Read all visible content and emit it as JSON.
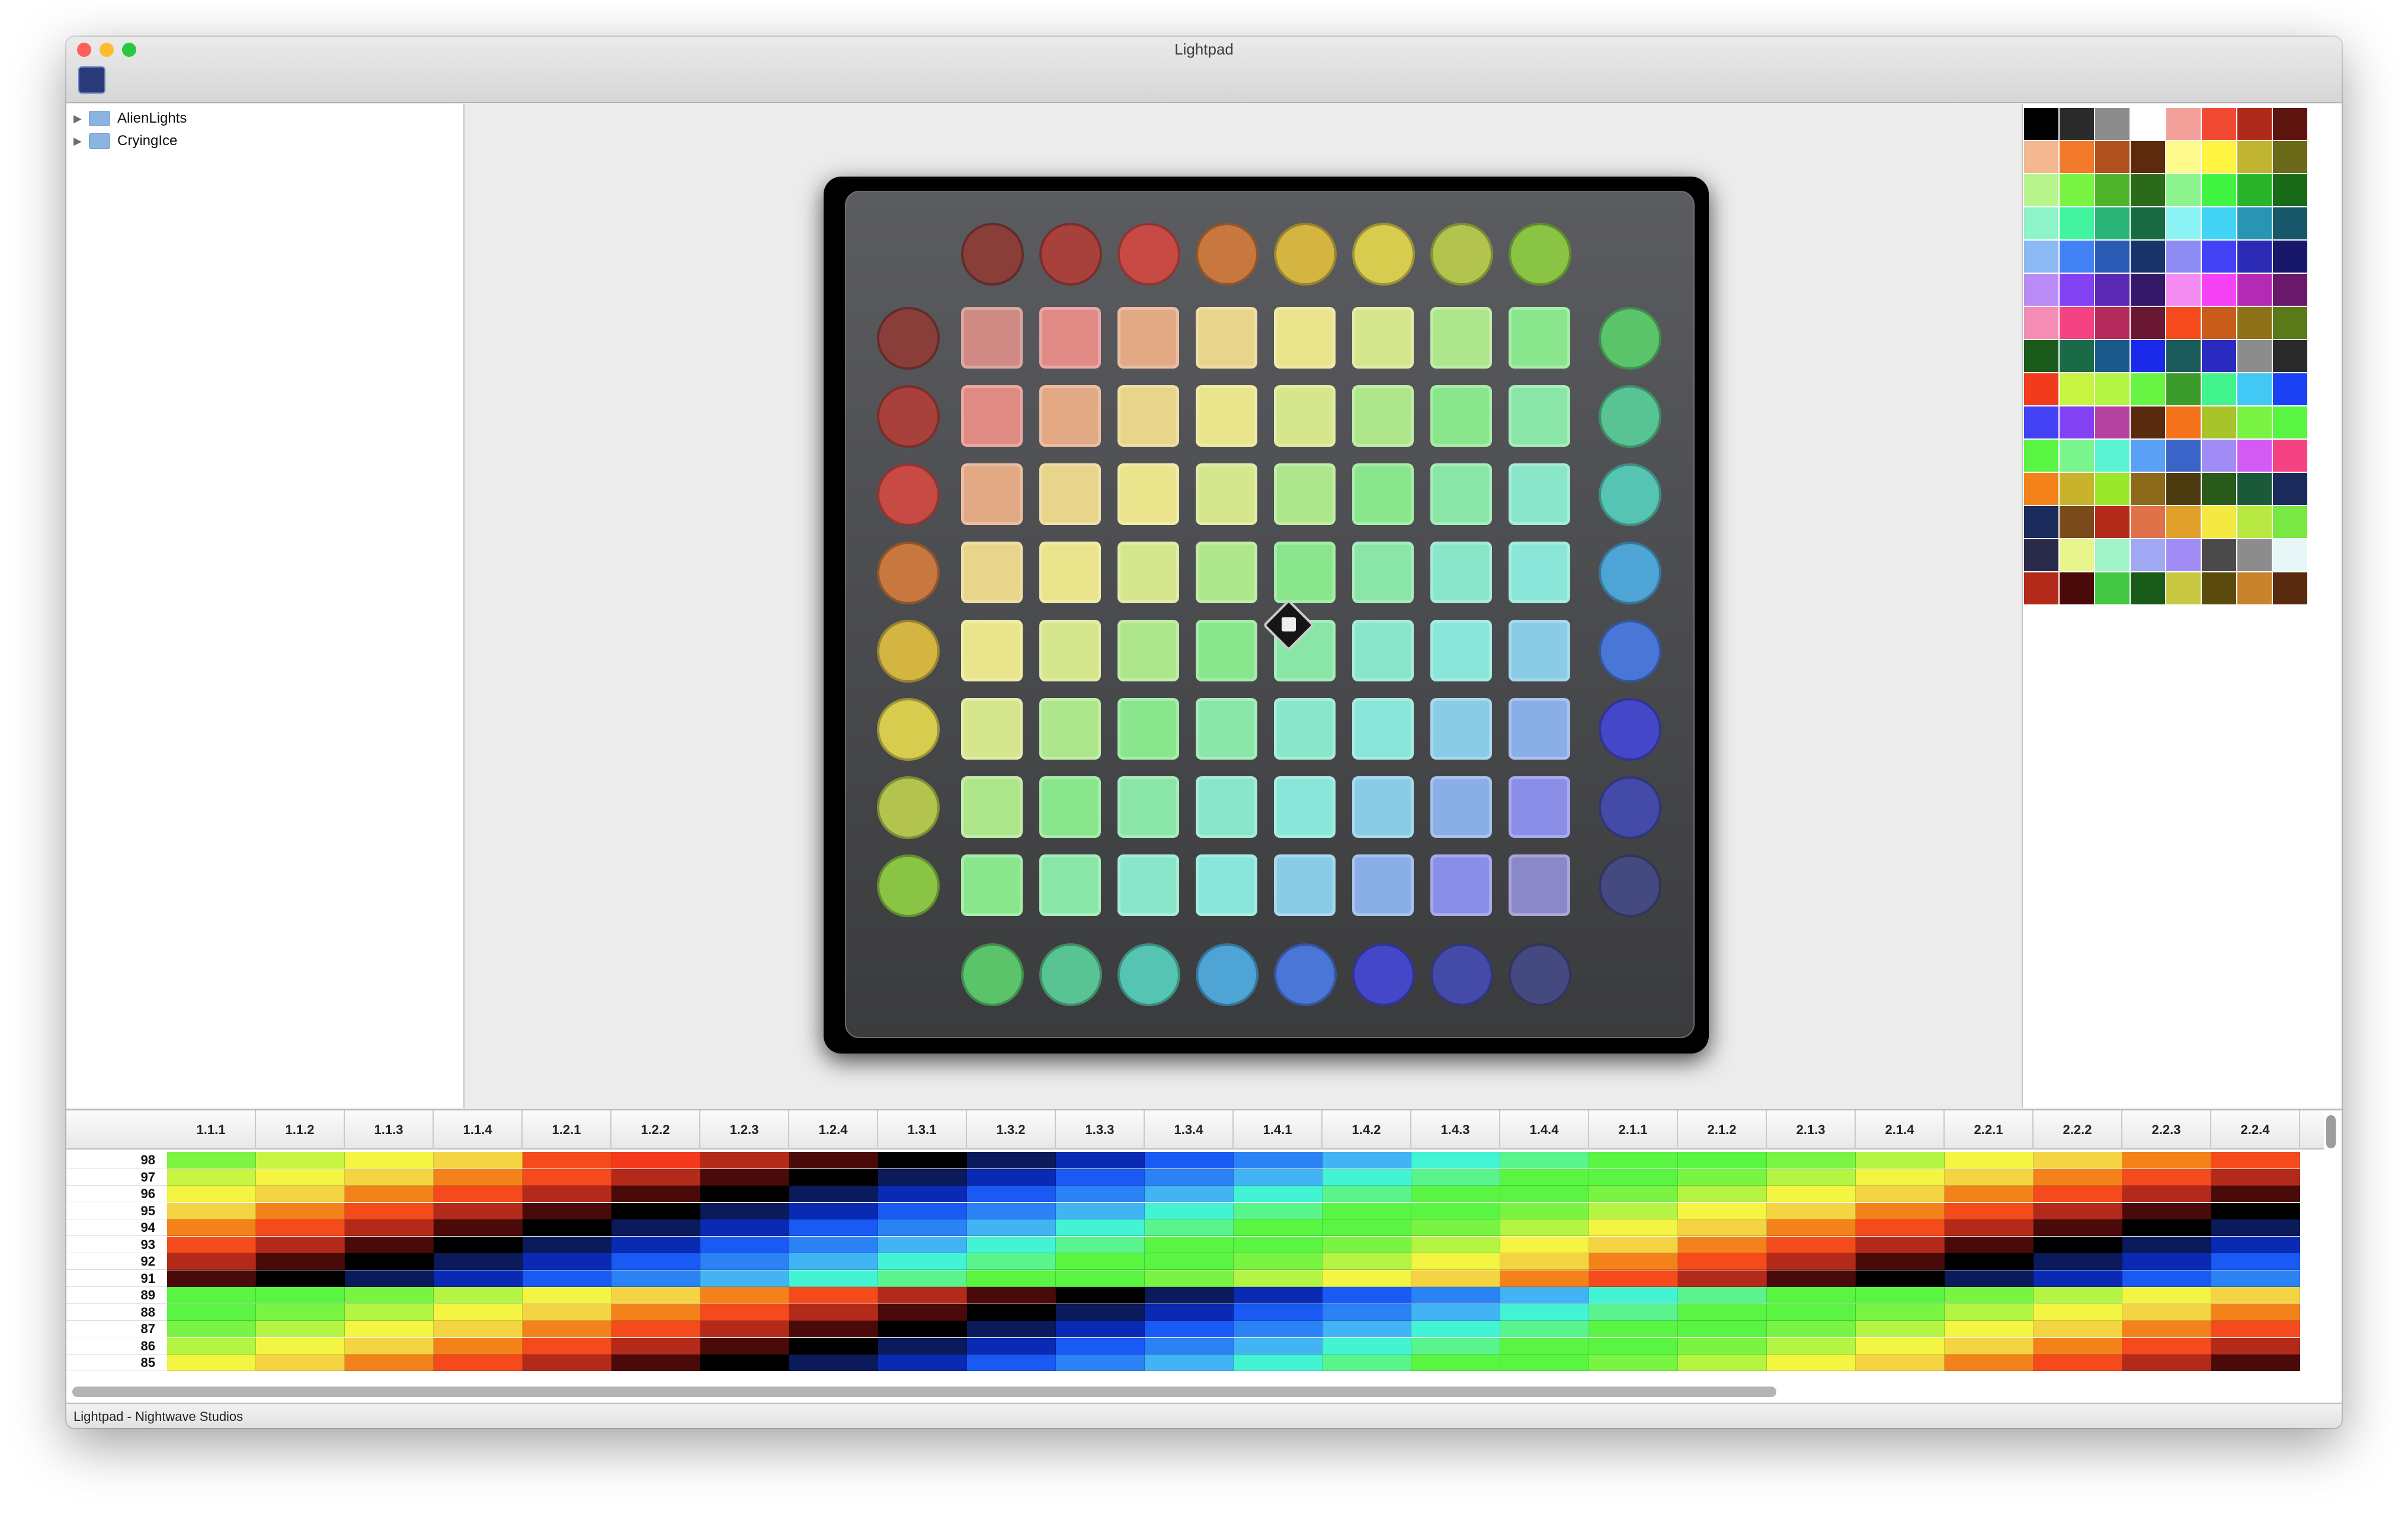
{
  "window": {
    "title": "Lightpad",
    "traffic_lights": {
      "close": "#ff5f57",
      "minimize": "#febc2e",
      "maximize": "#28c840"
    }
  },
  "toolbar": {
    "app_icon": "lightpad-app-icon"
  },
  "sidebar": {
    "items": [
      {
        "label": "AlienLights",
        "icon": "folder-icon",
        "expanded": false
      },
      {
        "label": "CryingIce",
        "icon": "folder-icon",
        "expanded": false
      }
    ]
  },
  "launchpad": {
    "top_buttons": [
      "#8a3e3a",
      "#a8403c",
      "#c84a44",
      "#c8773e",
      "#d4b542",
      "#d8cc4e",
      "#b2c44e",
      "#8ac444"
    ],
    "left_buttons": [
      "#8a3e3a",
      "#a8403c",
      "#c84a44",
      "#c8773e",
      "#d4b542",
      "#d8cc4e",
      "#b2c44e",
      "#8ac444"
    ],
    "right_buttons": [
      "#5bc46a",
      "#58c493",
      "#56c4b2",
      "#4ea4d4",
      "#4a76d8",
      "#4448c8",
      "#444aa8",
      "#444a80"
    ],
    "bottom_buttons": [
      "#5bc46a",
      "#58c493",
      "#56c4b2",
      "#4ea4d4",
      "#4a76d8",
      "#4448c8",
      "#444aa8",
      "#444a80"
    ],
    "pad_rows": [
      [
        "#cf8a84",
        "#e18a86",
        "#e3a884",
        "#e8d48a",
        "#eae48c",
        "#d6e68c",
        "#aee68c",
        "#8ae68c"
      ],
      [
        "#e08a84",
        "#e3a884",
        "#e8d48a",
        "#eae48c",
        "#d6e68c",
        "#aee68c",
        "#8ae68c",
        "#8ae6a6"
      ],
      [
        "#e3a884",
        "#e8d48a",
        "#eae48c",
        "#d6e68c",
        "#aee68c",
        "#8ae68c",
        "#8ae6a6",
        "#8ae6c8"
      ],
      [
        "#e8d48a",
        "#eae48c",
        "#d6e68c",
        "#aee68c",
        "#8ae68c",
        "#8ae6a6",
        "#8ae6c8",
        "#8ae6d8"
      ],
      [
        "#eae48c",
        "#d6e68c",
        "#aee68c",
        "#8ae68c",
        "#8ae6a6",
        "#8ae6c8",
        "#8ae6d8",
        "#8acce6"
      ],
      [
        "#d6e68c",
        "#aee68c",
        "#8ae68c",
        "#8ae6a6",
        "#8ae6c8",
        "#8ae6d8",
        "#8acce6",
        "#8aaee6"
      ],
      [
        "#aee68c",
        "#8ae68c",
        "#8ae6a6",
        "#8ae6c8",
        "#8ae6d8",
        "#8acce6",
        "#8aaee6",
        "#8a8ee6"
      ],
      [
        "#8ae68c",
        "#8ae6a6",
        "#8ae6c8",
        "#8ae6d8",
        "#8acce6",
        "#8aaee6",
        "#8a8ee6",
        "#8a88c8"
      ]
    ],
    "logo_icon": "novation-logo-icon"
  },
  "palette": {
    "swatches": [
      "#000000",
      "#2a2a2a",
      "#8c8c8c",
      "#ffffff",
      "#f4a09a",
      "#f24a32",
      "#b02a1c",
      "#5e140e",
      "#f4b890",
      "#f27a2a",
      "#b0501c",
      "#5e2a0e",
      "#fffa8c",
      "#fff442",
      "#c0b430",
      "#6a6a18",
      "#b8f48c",
      "#7af442",
      "#50b42a",
      "#2a6a18",
      "#8cf48c",
      "#42f442",
      "#2ab42a",
      "#186a18",
      "#8cf4c8",
      "#42f4a0",
      "#2ab478",
      "#186a42",
      "#8cf4f4",
      "#42d4f4",
      "#2a94b4",
      "#18566a",
      "#8cb8f4",
      "#4282f4",
      "#2a5ab4",
      "#18346a",
      "#8c8cf4",
      "#4242f4",
      "#2a2ab4",
      "#18186a",
      "#b88cf4",
      "#8242f4",
      "#5a2ab4",
      "#34186a",
      "#f48cf4",
      "#f442f4",
      "#b42ab4",
      "#6a186a",
      "#f48cb4",
      "#f44282",
      "#b42a5a",
      "#6a1834",
      "#f44a1c",
      "#c85c1a",
      "#8e7218",
      "#5a7a1a",
      "#1a5a1a",
      "#1a6a48",
      "#1a5a8a",
      "#1a2ae8",
      "#1a5a5a",
      "#2a2ac0",
      "#8c8c8c",
      "#2a2a2a",
      "#f23a1c",
      "#c8f442",
      "#b4f442",
      "#68f442",
      "#3a9a2a",
      "#42f48c",
      "#42c8f4",
      "#1a42f4",
      "#4242f4",
      "#8242f4",
      "#b442a0",
      "#5a2a0e",
      "#f4721a",
      "#a8c42a",
      "#7af442",
      "#5af442",
      "#5af442",
      "#7af48c",
      "#5af4d4",
      "#5aa0f4",
      "#3a64c8",
      "#a08cf4",
      "#d45af4",
      "#f44282",
      "#f4821a",
      "#c8b42a",
      "#9ae82a",
      "#8c6a1a",
      "#4a3a0e",
      "#2a5a1a",
      "#1a5a3a",
      "#1a2a5a",
      "#1a2a5a",
      "#7a4a1a",
      "#b42a1a",
      "#e0724a",
      "#e0a02a",
      "#f4e842",
      "#b8e842",
      "#7ae842",
      "#2a2a4a",
      "#e8f48c",
      "#a0f4c8",
      "#a0a8f4",
      "#a08cf4",
      "#4a4a4a",
      "#8c8c8c",
      "#e8f8f8",
      "#b42a1a",
      "#4a0a0a",
      "#42c842",
      "#1a5a1a",
      "#c8c842",
      "#5a4a0e",
      "#c8822a",
      "#5a2a0e"
    ]
  },
  "grid": {
    "columns": [
      "1.1.1",
      "1.1.2",
      "1.1.3",
      "1.1.4",
      "1.2.1",
      "1.2.2",
      "1.2.3",
      "1.2.4",
      "1.3.1",
      "1.3.2",
      "1.3.3",
      "1.3.4",
      "1.4.1",
      "1.4.2",
      "1.4.3",
      "1.4.4",
      "2.1.1",
      "2.1.2",
      "2.1.3",
      "2.1.4",
      "2.2.1",
      "2.2.2",
      "2.2.3",
      "2.2.4"
    ],
    "rows": [
      {
        "label": "98",
        "colors": [
          "#7df442",
          "#c8f442",
          "#f4f442",
          "#f4d442",
          "#f44a1c",
          "#f43a1c",
          "#b42a1a",
          "#4a0a0a",
          "#000000",
          "#0a1a5a",
          "#0a2ab4",
          "#1a5af4",
          "#2a82f4",
          "#42b4f4",
          "#42f4d4",
          "#5af48c",
          "#5af442",
          "#5af442",
          "#7af442",
          "#b4f442",
          "#f4f442",
          "#f4d442",
          "#f4821a",
          "#f44a1c"
        ]
      },
      {
        "label": "97",
        "colors": [
          "#c8f442",
          "#f4f442",
          "#f4d442",
          "#f4821a",
          "#f44a1c",
          "#b42a1a",
          "#4a0a0a",
          "#000000",
          "#0a1a5a",
          "#0a2ab4",
          "#1a5af4",
          "#2a82f4",
          "#42b4f4",
          "#42f4d4",
          "#5af48c",
          "#5af442",
          "#5af442",
          "#7af442",
          "#b4f442",
          "#f4f442",
          "#f4d442",
          "#f4821a",
          "#f44a1c",
          "#b42a1a"
        ]
      },
      {
        "label": "96",
        "colors": [
          "#f4f442",
          "#f4d442",
          "#f4821a",
          "#f44a1c",
          "#b42a1a",
          "#4a0a0a",
          "#000000",
          "#0a1a5a",
          "#0a2ab4",
          "#1a5af4",
          "#2a82f4",
          "#42b4f4",
          "#42f4d4",
          "#5af48c",
          "#5af442",
          "#5af442",
          "#7af442",
          "#b4f442",
          "#f4f442",
          "#f4d442",
          "#f4821a",
          "#f44a1c",
          "#b42a1a",
          "#4a0a0a"
        ]
      },
      {
        "label": "95",
        "colors": [
          "#f4d442",
          "#f4821a",
          "#f44a1c",
          "#b42a1a",
          "#4a0a0a",
          "#000000",
          "#0a1a5a",
          "#0a2ab4",
          "#1a5af4",
          "#2a82f4",
          "#42b4f4",
          "#42f4d4",
          "#5af48c",
          "#5af442",
          "#5af442",
          "#7af442",
          "#b4f442",
          "#f4f442",
          "#f4d442",
          "#f4821a",
          "#f44a1c",
          "#b42a1a",
          "#4a0a0a",
          "#000000"
        ]
      },
      {
        "label": "94",
        "colors": [
          "#f4821a",
          "#f44a1c",
          "#b42a1a",
          "#4a0a0a",
          "#000000",
          "#0a1a5a",
          "#0a2ab4",
          "#1a5af4",
          "#2a82f4",
          "#42b4f4",
          "#42f4d4",
          "#5af48c",
          "#5af442",
          "#5af442",
          "#7af442",
          "#b4f442",
          "#f4f442",
          "#f4d442",
          "#f4821a",
          "#f44a1c",
          "#b42a1a",
          "#4a0a0a",
          "#000000",
          "#0a1a5a"
        ]
      },
      {
        "label": "93",
        "colors": [
          "#f44a1c",
          "#b42a1a",
          "#4a0a0a",
          "#000000",
          "#0a1a5a",
          "#0a2ab4",
          "#1a5af4",
          "#2a82f4",
          "#42b4f4",
          "#42f4d4",
          "#5af48c",
          "#5af442",
          "#5af442",
          "#7af442",
          "#b4f442",
          "#f4f442",
          "#f4d442",
          "#f4821a",
          "#f44a1c",
          "#b42a1a",
          "#4a0a0a",
          "#000000",
          "#0a1a5a",
          "#0a2ab4"
        ]
      },
      {
        "label": "92",
        "colors": [
          "#b42a1a",
          "#4a0a0a",
          "#000000",
          "#0a1a5a",
          "#0a2ab4",
          "#1a5af4",
          "#2a82f4",
          "#42b4f4",
          "#42f4d4",
          "#5af48c",
          "#5af442",
          "#5af442",
          "#7af442",
          "#b4f442",
          "#f4f442",
          "#f4d442",
          "#f4821a",
          "#f44a1c",
          "#b42a1a",
          "#4a0a0a",
          "#000000",
          "#0a1a5a",
          "#0a2ab4",
          "#1a5af4"
        ]
      },
      {
        "label": "91",
        "colors": [
          "#4a0a0a",
          "#000000",
          "#0a1a5a",
          "#0a2ab4",
          "#1a5af4",
          "#2a82f4",
          "#42b4f4",
          "#42f4d4",
          "#5af48c",
          "#5af442",
          "#5af442",
          "#7af442",
          "#b4f442",
          "#f4f442",
          "#f4d442",
          "#f4821a",
          "#f44a1c",
          "#b42a1a",
          "#4a0a0a",
          "#000000",
          "#0a1a5a",
          "#0a2ab4",
          "#1a5af4",
          "#2a82f4"
        ]
      },
      {
        "label": "89",
        "colors": [
          "#5af442",
          "#5af442",
          "#7af442",
          "#b4f442",
          "#f4f442",
          "#f4d442",
          "#f4821a",
          "#f44a1c",
          "#b42a1a",
          "#4a0a0a",
          "#000000",
          "#0a1a5a",
          "#0a2ab4",
          "#1a5af4",
          "#2a82f4",
          "#42b4f4",
          "#42f4d4",
          "#5af48c",
          "#5af442",
          "#5af442",
          "#7af442",
          "#b4f442",
          "#f4f442",
          "#f4d442"
        ]
      },
      {
        "label": "88",
        "colors": [
          "#5af442",
          "#7af442",
          "#b4f442",
          "#f4f442",
          "#f4d442",
          "#f4821a",
          "#f44a1c",
          "#b42a1a",
          "#4a0a0a",
          "#000000",
          "#0a1a5a",
          "#0a2ab4",
          "#1a5af4",
          "#2a82f4",
          "#42b4f4",
          "#42f4d4",
          "#5af48c",
          "#5af442",
          "#5af442",
          "#7af442",
          "#b4f442",
          "#f4f442",
          "#f4d442",
          "#f4821a"
        ]
      },
      {
        "label": "87",
        "colors": [
          "#7af442",
          "#b4f442",
          "#f4f442",
          "#f4d442",
          "#f4821a",
          "#f44a1c",
          "#b42a1a",
          "#4a0a0a",
          "#000000",
          "#0a1a5a",
          "#0a2ab4",
          "#1a5af4",
          "#2a82f4",
          "#42b4f4",
          "#42f4d4",
          "#5af48c",
          "#5af442",
          "#5af442",
          "#7af442",
          "#b4f442",
          "#f4f442",
          "#f4d442",
          "#f4821a",
          "#f44a1c"
        ]
      },
      {
        "label": "86",
        "colors": [
          "#b4f442",
          "#f4f442",
          "#f4d442",
          "#f4821a",
          "#f44a1c",
          "#b42a1a",
          "#4a0a0a",
          "#000000",
          "#0a1a5a",
          "#0a2ab4",
          "#1a5af4",
          "#2a82f4",
          "#42b4f4",
          "#42f4d4",
          "#5af48c",
          "#5af442",
          "#5af442",
          "#7af442",
          "#b4f442",
          "#f4f442",
          "#f4d442",
          "#f4821a",
          "#f44a1c",
          "#b42a1a"
        ]
      },
      {
        "label": "85",
        "colors": [
          "#f4f442",
          "#f4d442",
          "#f4821a",
          "#f44a1c",
          "#b42a1a",
          "#4a0a0a",
          "#000000",
          "#0a1a5a",
          "#0a2ab4",
          "#1a5af4",
          "#2a82f4",
          "#42b4f4",
          "#42f4d4",
          "#5af48c",
          "#5af442",
          "#5af442",
          "#7af442",
          "#b4f442",
          "#f4f442",
          "#f4d442",
          "#f4821a",
          "#f44a1c",
          "#b42a1a",
          "#4a0a0a"
        ]
      }
    ]
  },
  "status": {
    "text": "Lightpad - Nightwave Studios"
  }
}
